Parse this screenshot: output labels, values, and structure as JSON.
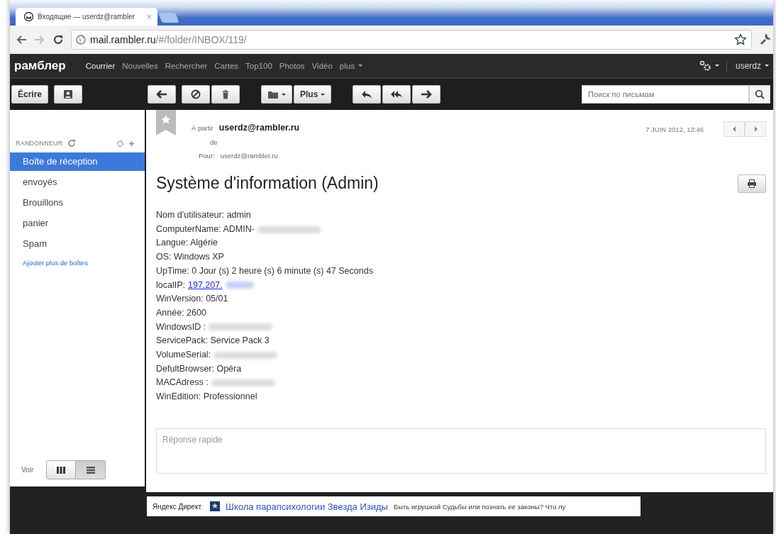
{
  "browser": {
    "tab": {
      "title": "Входящие — userdz@rambler",
      "close": "×"
    },
    "url": {
      "host": "mail.rambler.ru",
      "path": "/#/folder/INBOX/119/"
    }
  },
  "nav": {
    "brand": "рамблер",
    "links": [
      {
        "label": "Courrier",
        "selected": true
      },
      {
        "label": "Nouvelles",
        "selected": false
      },
      {
        "label": "Rechercher",
        "selected": false
      },
      {
        "label": "Cartes",
        "selected": false
      },
      {
        "label": "Top100",
        "selected": false
      },
      {
        "label": "Photos",
        "selected": false
      },
      {
        "label": "Vidéo",
        "selected": false
      },
      {
        "label": "plus",
        "selected": false,
        "dropdown": true
      }
    ],
    "user": "userdz"
  },
  "toolbar": {
    "compose": "Écrire",
    "more": "Plus",
    "search": {
      "placeholder": "Поиск по письмам"
    }
  },
  "sidebar": {
    "account": "RANDONNEUR",
    "folders": [
      {
        "label": "Boîte de réception",
        "selected": true
      },
      {
        "label": "envoyés",
        "selected": false
      },
      {
        "label": "Brouillons",
        "selected": false
      },
      {
        "label": "panier",
        "selected": false
      },
      {
        "label": "Spam",
        "selected": false
      }
    ],
    "add_link": "Ajouter plus de boîtes",
    "view_label": "Voir",
    "views": [
      {
        "kind": "columns",
        "selected": false
      },
      {
        "kind": "list",
        "selected": true
      }
    ]
  },
  "message": {
    "from_label": "À partir",
    "sender": "userdz@rambler.ru",
    "from_suffix": "de",
    "to_label": "Pour:",
    "recipient": "userdz@rambler.ru",
    "date": "7 JUIN 2012, 13:46",
    "subject": "Système d'information (Admin)",
    "body": [
      {
        "text": "Nom d'utilisateur: admin"
      },
      {
        "text": "ComputerName: ADMIN-",
        "redacted": true
      },
      {
        "text": "Langue: Algérie"
      },
      {
        "text": "OS: Windows XP"
      },
      {
        "text": "UpTime: 0 Jour (s) 2 heure (s) 6 minute (s) 47 Seconds"
      },
      {
        "text": "localIP:",
        "link": "197.207.",
        "redacted": true
      },
      {
        "text": "WinVersion: 05/01"
      },
      {
        "text": "Année: 2600"
      },
      {
        "text": "WindowsID :",
        "redacted": true
      },
      {
        "text": "ServicePack: Service Pack 3"
      },
      {
        "text": "VolumeSerial:",
        "redacted": true
      },
      {
        "text": "DefultBrowser: Opéra"
      },
      {
        "text": "MACAdress :",
        "redacted": true
      },
      {
        "text": "WinEdition: Professionnel"
      }
    ],
    "reply_placeholder": "Réponse rapide"
  },
  "ad": {
    "source": "Яндекс Директ",
    "link": "Школа парапсихологии Звезда Изиды",
    "text": "Быть игрушкой Судьбы или познать ее законы? Что лу"
  }
}
